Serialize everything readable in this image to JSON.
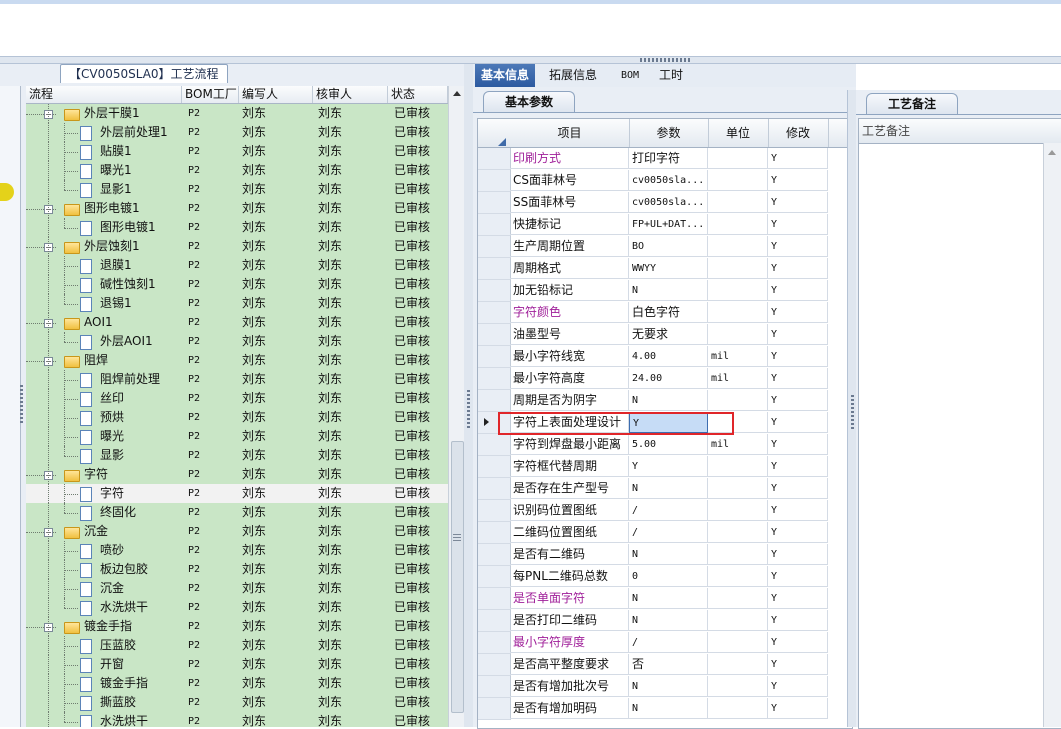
{
  "left_panel": {
    "doc_tab": "【CV0050SLA0】工艺流程",
    "columns": [
      "流程",
      "BOM工厂",
      "编写人",
      "核审人",
      "状态"
    ],
    "rows": [
      {
        "level": 0,
        "kind": "folder",
        "label": "外层干膜1",
        "bom": "P2",
        "editor": "刘东",
        "reviewer": "刘东",
        "status": "已审核"
      },
      {
        "level": 1,
        "kind": "doc",
        "label": "外层前处理1",
        "bom": "P2",
        "editor": "刘东",
        "reviewer": "刘东",
        "status": "已审核"
      },
      {
        "level": 1,
        "kind": "doc",
        "label": "贴膜1",
        "bom": "P2",
        "editor": "刘东",
        "reviewer": "刘东",
        "status": "已审核"
      },
      {
        "level": 1,
        "kind": "doc",
        "label": "曝光1",
        "bom": "P2",
        "editor": "刘东",
        "reviewer": "刘东",
        "status": "已审核"
      },
      {
        "level": 1,
        "kind": "doc",
        "label": "显影1",
        "bom": "P2",
        "editor": "刘东",
        "reviewer": "刘东",
        "status": "已审核"
      },
      {
        "level": 0,
        "kind": "folder",
        "label": "图形电镀1",
        "bom": "P2",
        "editor": "刘东",
        "reviewer": "刘东",
        "status": "已审核"
      },
      {
        "level": 1,
        "kind": "doc",
        "label": "图形电镀1",
        "bom": "P2",
        "editor": "刘东",
        "reviewer": "刘东",
        "status": "已审核"
      },
      {
        "level": 0,
        "kind": "folder",
        "label": "外层蚀刻1",
        "bom": "P2",
        "editor": "刘东",
        "reviewer": "刘东",
        "status": "已审核"
      },
      {
        "level": 1,
        "kind": "doc",
        "label": "退膜1",
        "bom": "P2",
        "editor": "刘东",
        "reviewer": "刘东",
        "status": "已审核"
      },
      {
        "level": 1,
        "kind": "doc",
        "label": "碱性蚀刻1",
        "bom": "P2",
        "editor": "刘东",
        "reviewer": "刘东",
        "status": "已审核"
      },
      {
        "level": 1,
        "kind": "doc",
        "label": "退锡1",
        "bom": "P2",
        "editor": "刘东",
        "reviewer": "刘东",
        "status": "已审核"
      },
      {
        "level": 0,
        "kind": "folder",
        "label": "AOI1",
        "bom": "P2",
        "editor": "刘东",
        "reviewer": "刘东",
        "status": "已审核"
      },
      {
        "level": 1,
        "kind": "doc",
        "label": "外层AOI1",
        "bom": "P2",
        "editor": "刘东",
        "reviewer": "刘东",
        "status": "已审核"
      },
      {
        "level": 0,
        "kind": "folder",
        "label": "阻焊",
        "bom": "P2",
        "editor": "刘东",
        "reviewer": "刘东",
        "status": "已审核"
      },
      {
        "level": 1,
        "kind": "doc",
        "label": "阻焊前处理",
        "bom": "P2",
        "editor": "刘东",
        "reviewer": "刘东",
        "status": "已审核"
      },
      {
        "level": 1,
        "kind": "doc",
        "label": "丝印",
        "bom": "P2",
        "editor": "刘东",
        "reviewer": "刘东",
        "status": "已审核"
      },
      {
        "level": 1,
        "kind": "doc",
        "label": "预烘",
        "bom": "P2",
        "editor": "刘东",
        "reviewer": "刘东",
        "status": "已审核"
      },
      {
        "level": 1,
        "kind": "doc",
        "label": "曝光",
        "bom": "P2",
        "editor": "刘东",
        "reviewer": "刘东",
        "status": "已审核"
      },
      {
        "level": 1,
        "kind": "doc",
        "label": "显影",
        "bom": "P2",
        "editor": "刘东",
        "reviewer": "刘东",
        "status": "已审核"
      },
      {
        "level": 0,
        "kind": "folder",
        "label": "字符",
        "bom": "P2",
        "editor": "刘东",
        "reviewer": "刘东",
        "status": "已审核"
      },
      {
        "level": 1,
        "kind": "doc",
        "label": "字符",
        "bom": "P2",
        "editor": "刘东",
        "reviewer": "刘东",
        "status": "已审核",
        "selected": true
      },
      {
        "level": 1,
        "kind": "doc",
        "label": "终固化",
        "bom": "P2",
        "editor": "刘东",
        "reviewer": "刘东",
        "status": "已审核"
      },
      {
        "level": 0,
        "kind": "folder",
        "label": "沉金",
        "bom": "P2",
        "editor": "刘东",
        "reviewer": "刘东",
        "status": "已审核"
      },
      {
        "level": 1,
        "kind": "doc",
        "label": "喷砂",
        "bom": "P2",
        "editor": "刘东",
        "reviewer": "刘东",
        "status": "已审核"
      },
      {
        "level": 1,
        "kind": "doc",
        "label": "板边包胶",
        "bom": "P2",
        "editor": "刘东",
        "reviewer": "刘东",
        "status": "已审核"
      },
      {
        "level": 1,
        "kind": "doc",
        "label": "沉金",
        "bom": "P2",
        "editor": "刘东",
        "reviewer": "刘东",
        "status": "已审核"
      },
      {
        "level": 1,
        "kind": "doc",
        "label": "水洗烘干",
        "bom": "P2",
        "editor": "刘东",
        "reviewer": "刘东",
        "status": "已审核"
      },
      {
        "level": 0,
        "kind": "folder",
        "label": "镀金手指",
        "bom": "P2",
        "editor": "刘东",
        "reviewer": "刘东",
        "status": "已审核"
      },
      {
        "level": 1,
        "kind": "doc",
        "label": "压蓝胶",
        "bom": "P2",
        "editor": "刘东",
        "reviewer": "刘东",
        "status": "已审核"
      },
      {
        "level": 1,
        "kind": "doc",
        "label": "开窗",
        "bom": "P2",
        "editor": "刘东",
        "reviewer": "刘东",
        "status": "已审核"
      },
      {
        "level": 1,
        "kind": "doc",
        "label": "镀金手指",
        "bom": "P2",
        "editor": "刘东",
        "reviewer": "刘东",
        "status": "已审核"
      },
      {
        "level": 1,
        "kind": "doc",
        "label": "撕蓝胶",
        "bom": "P2",
        "editor": "刘东",
        "reviewer": "刘东",
        "status": "已审核"
      },
      {
        "level": 1,
        "kind": "doc",
        "label": "水洗烘干",
        "bom": "P2",
        "editor": "刘东",
        "reviewer": "刘东",
        "status": "已审核"
      }
    ]
  },
  "middle_panel": {
    "tabs": [
      "基本信息",
      "拓展信息",
      "BOM",
      "工时"
    ],
    "active_tab": 0,
    "sub_tab": "基本参数",
    "columns": [
      "项目",
      "参数",
      "单位",
      "修改"
    ],
    "rows": [
      {
        "item": "印刷方式",
        "param": "打印字符",
        "unit": "",
        "mod": "Y",
        "purple": true
      },
      {
        "item": "CS面菲林号",
        "param": "cv0050sla...",
        "unit": "",
        "mod": "Y",
        "mono": true
      },
      {
        "item": "SS面菲林号",
        "param": "cv0050sla...",
        "unit": "",
        "mod": "Y",
        "mono": true
      },
      {
        "item": "快捷标记",
        "param": "FP+UL+DAT...",
        "unit": "",
        "mod": "Y",
        "mono": true
      },
      {
        "item": "生产周期位置",
        "param": "BO",
        "unit": "",
        "mod": "Y",
        "mono": true
      },
      {
        "item": "周期格式",
        "param": "WWYY",
        "unit": "",
        "mod": "Y",
        "mono": true
      },
      {
        "item": "加无铅标记",
        "param": "N",
        "unit": "",
        "mod": "Y",
        "mono": true
      },
      {
        "item": "字符颜色",
        "param": "白色字符",
        "unit": "",
        "mod": "Y",
        "purple": true
      },
      {
        "item": "油墨型号",
        "param": "无要求",
        "unit": "",
        "mod": "Y"
      },
      {
        "item": "最小字符线宽",
        "param": "4.00",
        "unit": "mil",
        "mod": "Y",
        "mono": true
      },
      {
        "item": "最小字符高度",
        "param": "24.00",
        "unit": "mil",
        "mod": "Y",
        "mono": true
      },
      {
        "item": "周期是否为阴字",
        "param": "N",
        "unit": "",
        "mod": "Y",
        "mono": true
      },
      {
        "item": "字符上表面处理设计",
        "param": "Y",
        "unit": "",
        "mod": "Y",
        "mono": true,
        "editing": true
      },
      {
        "item": "字符到焊盘最小距离",
        "param": "5.00",
        "unit": "mil",
        "mod": "Y",
        "mono": true
      },
      {
        "item": "字符框代替周期",
        "param": "Y",
        "unit": "",
        "mod": "Y",
        "mono": true
      },
      {
        "item": "是否存在生产型号",
        "param": "N",
        "unit": "",
        "mod": "Y",
        "mono": true
      },
      {
        "item": "识别码位置图纸",
        "param": "/",
        "unit": "",
        "mod": "Y",
        "mono": true
      },
      {
        "item": "二维码位置图纸",
        "param": "/",
        "unit": "",
        "mod": "Y",
        "mono": true
      },
      {
        "item": "是否有二维码",
        "param": "N",
        "unit": "",
        "mod": "Y",
        "mono": true
      },
      {
        "item": "每PNL二维码总数",
        "param": "0",
        "unit": "",
        "mod": "Y",
        "mono": true
      },
      {
        "item": "是否单面字符",
        "param": "N",
        "unit": "",
        "mod": "Y",
        "mono": true,
        "purple": true
      },
      {
        "item": "是否打印二维码",
        "param": "N",
        "unit": "",
        "mod": "Y",
        "mono": true
      },
      {
        "item": "最小字符厚度",
        "param": "/",
        "unit": "",
        "mod": "Y",
        "mono": true,
        "purple": true
      },
      {
        "item": "是否高平整度要求",
        "param": "否",
        "unit": "",
        "mod": "Y"
      },
      {
        "item": "是否有增加批次号",
        "param": "N",
        "unit": "",
        "mod": "Y",
        "mono": true
      },
      {
        "item": "是否有增加明码",
        "param": "N",
        "unit": "",
        "mod": "Y",
        "mono": true
      }
    ]
  },
  "right_panel": {
    "tab": "工艺备注",
    "column": "工艺备注"
  },
  "colors": {
    "tree_bg": "#c9e6c6",
    "purple_item": "#a0209a",
    "active_tab": "#2c5aa0",
    "highlight_box": "#e0262a"
  }
}
